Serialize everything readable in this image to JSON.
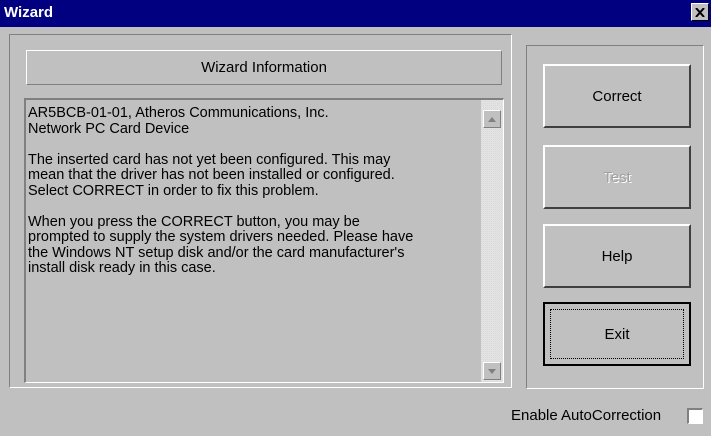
{
  "window": {
    "title": "Wizard",
    "close_icon": "close-icon"
  },
  "info_header": "Wizard Information",
  "message": {
    "paragraphs": [
      [
        "AR5BCB-01-01, Atheros Communications, Inc.",
        "Network PC Card Device"
      ],
      [
        "The inserted card has not yet been configured.  This may",
        "mean that the driver has not been installed or configured.",
        "Select CORRECT in order to fix this problem."
      ],
      [
        "When you press the CORRECT button, you may be",
        "prompted to supply the system drivers needed.  Please have",
        "the Windows NT setup disk and/or the card manufacturer's",
        "install disk ready in this case."
      ]
    ]
  },
  "buttons": {
    "correct": "Correct",
    "test": "Test",
    "help": "Help",
    "exit": "Exit"
  },
  "auto_correction": {
    "label": "Enable AutoCorrection",
    "checked": false
  },
  "colors": {
    "titlebar": "#000080",
    "face": "#c0c0c0"
  }
}
